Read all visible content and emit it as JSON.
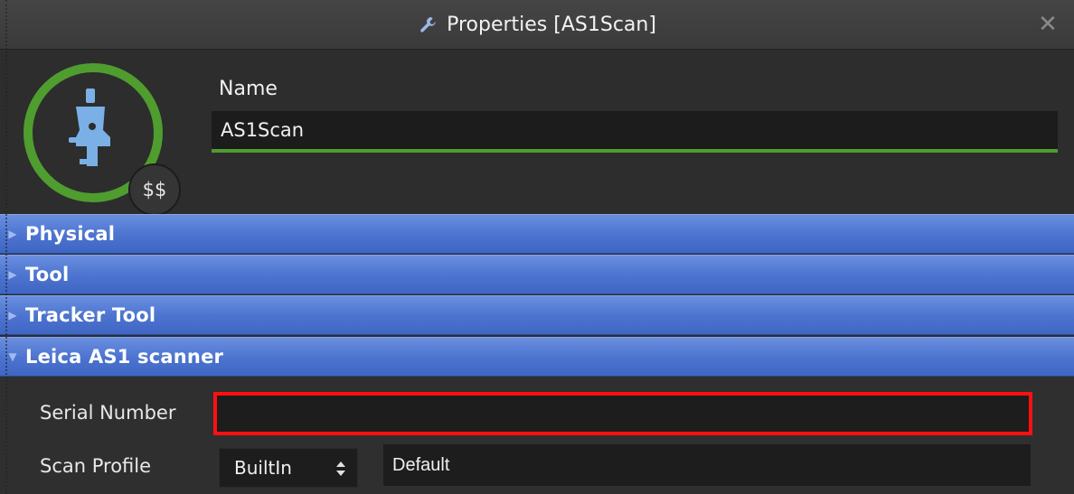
{
  "window": {
    "title": "Properties [AS1Scan]",
    "close_glyph": "✕"
  },
  "header": {
    "name_label": "Name",
    "name_value": "AS1Scan",
    "cost_badge": "$$",
    "icon": "scanner-probe-icon",
    "ring_color": "#4f9d2f"
  },
  "sections": [
    {
      "label": "Physical",
      "expanded": false
    },
    {
      "label": "Tool",
      "expanded": false
    },
    {
      "label": "Tracker Tool",
      "expanded": false
    },
    {
      "label": "Leica AS1 scanner",
      "expanded": true
    }
  ],
  "scanner": {
    "serial_label": "Serial Number",
    "serial_value": "",
    "serial_highlight_color": "#ff1010",
    "profile_label": "Scan Profile",
    "profile_source": "BuiltIn",
    "profile_name": "Default"
  },
  "colors": {
    "section_bar": "#4b73cf",
    "accent_green": "#4f9d2f"
  }
}
